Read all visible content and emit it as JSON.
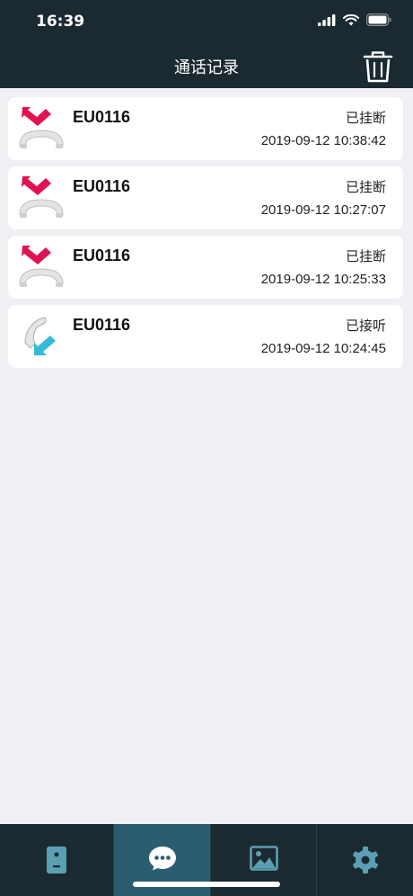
{
  "status_bar": {
    "time": "16:39"
  },
  "header": {
    "title": "通话记录"
  },
  "calls": [
    {
      "name": "EU0116",
      "status": "已挂断",
      "time": "2019-09-12 10:38:42",
      "type": "missed"
    },
    {
      "name": "EU0116",
      "status": "已挂断",
      "time": "2019-09-12 10:27:07",
      "type": "missed"
    },
    {
      "name": "EU0116",
      "status": "已挂断",
      "time": "2019-09-12 10:25:33",
      "type": "missed"
    },
    {
      "name": "EU0116",
      "status": "已接听",
      "time": "2019-09-12 10:24:45",
      "type": "answered"
    }
  ],
  "tabs": [
    {
      "icon": "intercom-device-icon",
      "active": false
    },
    {
      "icon": "chat-bubble-icon",
      "active": true
    },
    {
      "icon": "image-icon",
      "active": false
    },
    {
      "icon": "gear-icon",
      "active": false
    }
  ],
  "colors": {
    "bar_background": "#1b2a31",
    "active_tab": "#2a5d70",
    "missed_arrow": "#e0124f",
    "answered_arrow": "#34b9d6",
    "page_background": "#efeff4"
  }
}
